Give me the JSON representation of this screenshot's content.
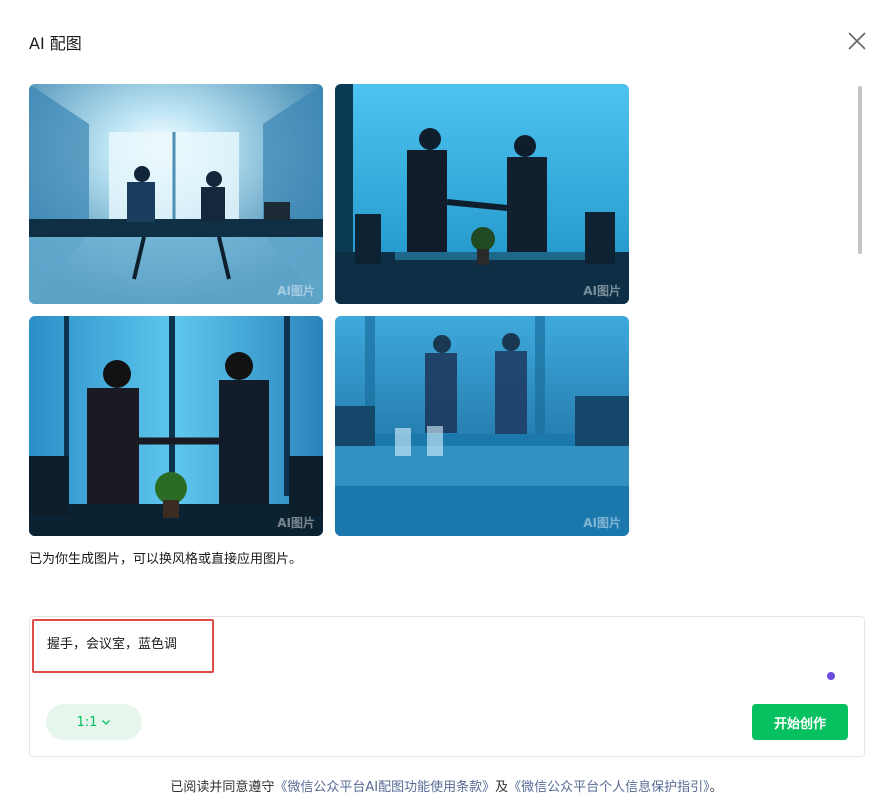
{
  "dialog": {
    "title": "AI 配图",
    "close_icon": "close-icon"
  },
  "images": [
    {
      "watermark": "AI图片",
      "scene": "bright-window-meeting-room-handshake"
    },
    {
      "watermark": "AI图片",
      "scene": "blue-wall-two-men-handshake"
    },
    {
      "watermark": "AI图片",
      "scene": "woman-and-man-handshake-window"
    },
    {
      "watermark": "AI图片",
      "scene": "blurred-conference-table-handshake"
    }
  ],
  "hint": "已为你生成图片，可以换风格或直接应用图片。",
  "prompt": {
    "value": "握手，会议室，蓝色调",
    "highlight_color": "#e04b45"
  },
  "controls": {
    "ratio_label": "1:1",
    "create_label": "开始创作"
  },
  "agreement": {
    "prefix": "已阅读并同意遵守",
    "link1": "《微信公众平台AI配图功能使用条款》",
    "middle": "及",
    "link2": "《微信公众平台个人信息保护指引》",
    "suffix": "。"
  },
  "colors": {
    "accent": "#07c160",
    "link": "#576b95",
    "dot": "#6a4be0"
  }
}
